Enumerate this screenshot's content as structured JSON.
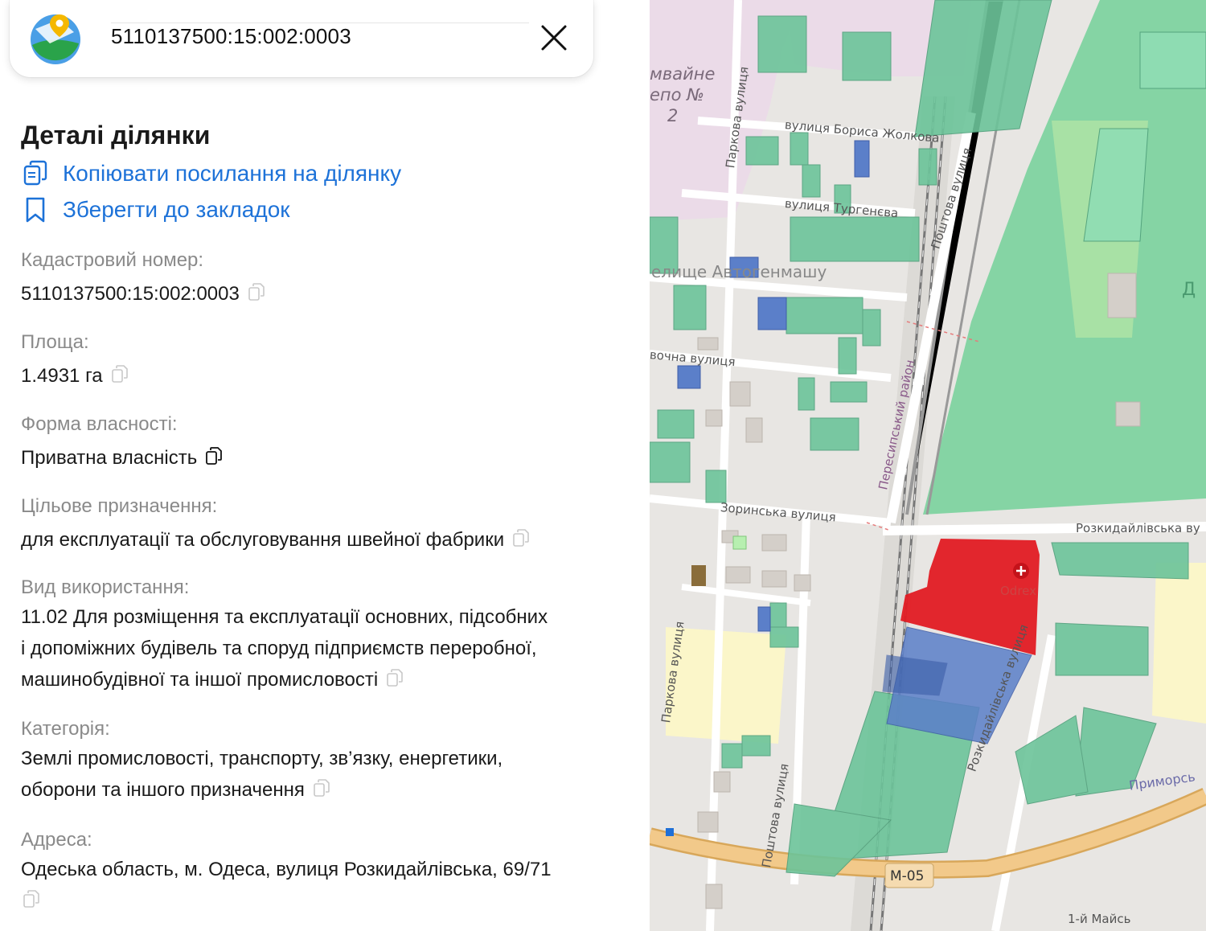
{
  "search": {
    "value": "5110137500:15:002:0003"
  },
  "details": {
    "title": "Деталі ділянки",
    "copy_link_label": "Копіювати посилання на ділянку",
    "bookmark_label": "Зберегти до закладок"
  },
  "fields": {
    "cadastral_label": "Кадастровий номер:",
    "cadastral_value": "5110137500:15:002:0003",
    "area_label": "Площа:",
    "area_value": "1.4931 га",
    "ownership_label": "Форма власності:",
    "ownership_value": "Приватна власність",
    "purpose_label": "Цільове призначення:",
    "purpose_value": "для експлуатації та обслуговування швейної фабрики",
    "usage_label": "Вид використання:",
    "usage_line1": "11.02 Для розміщення та експлуатації основних, підсобних",
    "usage_line2": "і допоміжних будівель та споруд підприємств переробної,",
    "usage_line3": "машинобудівної та іншої промисловості",
    "category_label": "Категорія:",
    "category_line1": "Землі промисловості, транспорту, зв’язку, енергетики,",
    "category_line2": "оборони та іншого призначення",
    "address_label": "Адреса:",
    "address_value": "Одеська область, м. Одеса, вулиця Розкидайлівська, 69/71"
  },
  "map": {
    "labels": {
      "depot1": "мвайне",
      "depot2": "епо №",
      "depot3": "2",
      "zholkova": "вулиця Бориса Жолкова",
      "turgeneva": "вулиця Тургенєва",
      "avtogen": "елище Автогенмашу",
      "parkova_top": "Паркова вулиця",
      "poshtova_top": "Поштова вулиця",
      "ochna": "вочна вулиця",
      "peresyp": "Пересипський район",
      "zorinska": "Зоринська вулиця",
      "rozkyd_top": "Розкидайлівська ву",
      "odrex": "Odrex",
      "parkova_bottom": "Паркова вулиця",
      "rozkyd_diag": "Розкидайлівська вулиця",
      "poshtova_bottom": "Поштова вулиця",
      "prymorska": "Приморсь",
      "m05": "М-05",
      "maisk": "1-й Майсь",
      "d_letter": "Д"
    },
    "colors": {
      "parcel_selected": "#e21b23",
      "parcel_private": "#6cc49a",
      "parcel_state": "#5b7fc9",
      "park": "#7fd3a0",
      "industrial": "#ebdbe8",
      "residential": "#fbf6c9",
      "road_major": "#f2c98a"
    }
  }
}
